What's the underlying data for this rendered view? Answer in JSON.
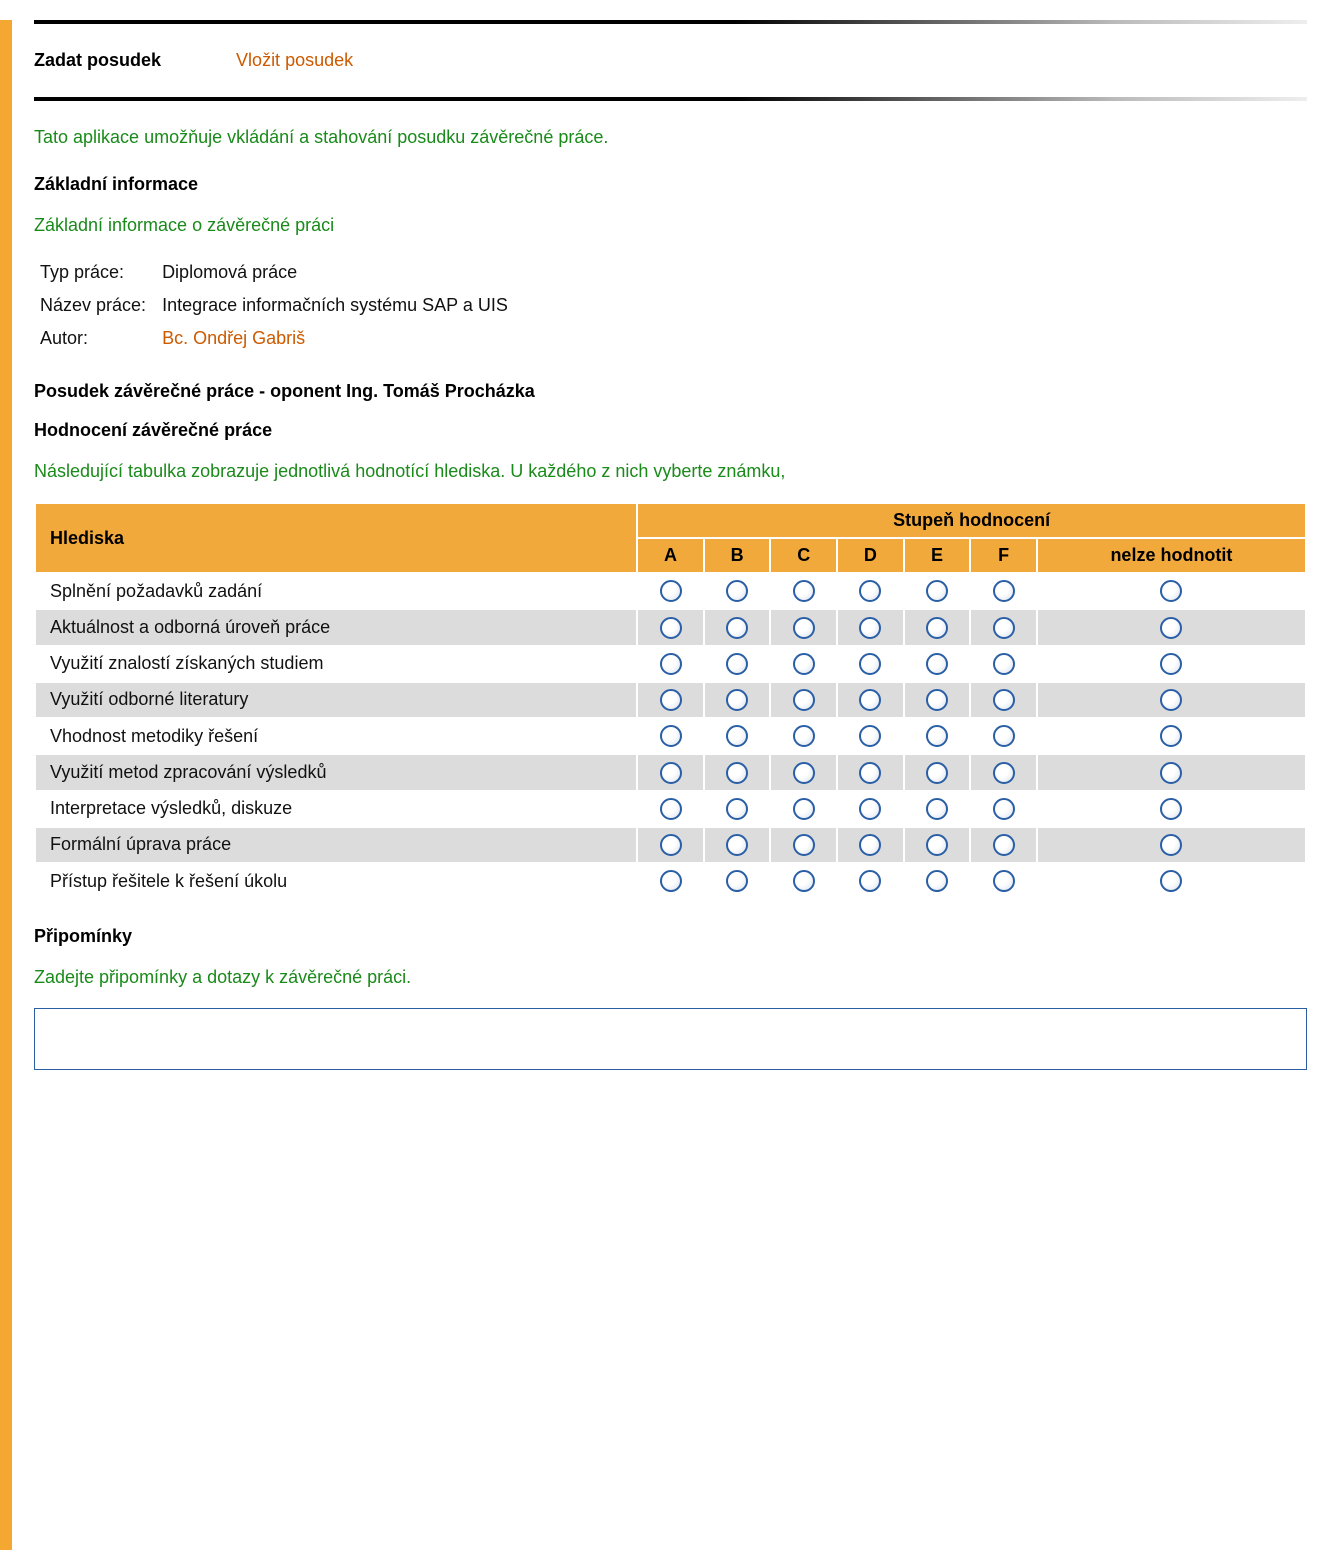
{
  "tabs": {
    "active": "Zadat posudek",
    "link": "Vložit posudek"
  },
  "intro": "Tato aplikace umožňuje vkládání a stahování posudku závěrečné práce.",
  "headings": {
    "basic_info": "Základní informace",
    "basic_info_sub": "Základní informace o závěrečné práci",
    "review": "Posudek závěrečné práce - oponent Ing. Tomáš Procházka",
    "rating": "Hodnocení závěrečné práce",
    "rating_sub": "Následující tabulka zobrazuje jednotlivá hodnotící hlediska. U každého z nich vyberte známku,",
    "comments": "Připomínky",
    "comments_sub": "Zadejte připomínky a dotazy k závěrečné práci."
  },
  "info": {
    "type_label": "Typ práce:",
    "type_value": "Diplomová práce",
    "title_label": "Název práce:",
    "title_value": "Integrace informačních systému SAP a UIS",
    "author_label": "Autor:",
    "author_value": "Bc. Ondřej Gabriš"
  },
  "table": {
    "criteria_header": "Hlediska",
    "grade_group_header": "Stupeň hodnocení",
    "grades": [
      "A",
      "B",
      "C",
      "D",
      "E",
      "F",
      "nelze hodnotit"
    ],
    "rows": [
      "Splnění požadavků zadání",
      "Aktuálnost a odborná úroveň práce",
      "Využití znalostí získaných studiem",
      "Využití odborné literatury",
      "Vhodnost metodiky řešení",
      "Využití metod zpracování výsledků",
      "Interpretace výsledků, diskuze",
      "Formální úprava práce",
      "Přístup řešitele k řešení úkolu"
    ]
  }
}
